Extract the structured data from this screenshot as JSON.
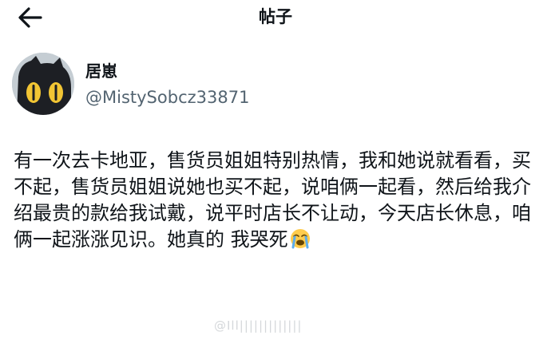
{
  "header": {
    "back_icon": "arrow-left-icon",
    "title": "帖子"
  },
  "author": {
    "avatar_icon": "cat-avatar",
    "display_name": "居崽",
    "handle": "@MistySobcz33871"
  },
  "post": {
    "text": "有一次去卡地亚，售货员姐姐特别热情，我和她说就看看，买不起，售货员姐姐说她也买不起，说咱俩一起看，然后给我介绍最贵的款给我试戴，说平时店长不让动，今天店长休息，咱俩一起涨涨见识。她真的 我哭死",
    "emoji_icon": "loudly-crying-face-emoji"
  },
  "watermark": {
    "text": "@Ill|||||||||||||"
  },
  "colors": {
    "text": "#0f1419",
    "secondary": "#536471",
    "background": "#ffffff"
  }
}
